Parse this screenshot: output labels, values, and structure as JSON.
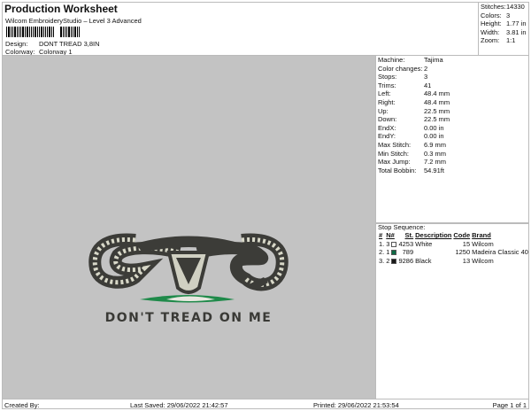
{
  "header": {
    "title": "Production Worksheet",
    "subtitle": "Wilcom EmbroideryStudio – Level 3 Advanced",
    "design_label": "Design:",
    "design_value": "DONT TREAD 3,8IN",
    "colorway_label": "Colorway:",
    "colorway_value": "Colorway 1"
  },
  "stats": [
    {
      "k": "Stitches:",
      "v": "14330"
    },
    {
      "k": "Colors:",
      "v": "3"
    },
    {
      "k": "Height:",
      "v": "1.77 in"
    },
    {
      "k": "Width:",
      "v": "3.81 in"
    },
    {
      "k": "Zoom:",
      "v": "1:1"
    }
  ],
  "details": [
    {
      "k": "Machine:",
      "v": "Tajima"
    },
    {
      "k": "Color changes:",
      "v": "2"
    },
    {
      "k": "Stops:",
      "v": "3"
    },
    {
      "k": "Trims:",
      "v": "41"
    },
    {
      "k": "Left:",
      "v": "48.4 mm"
    },
    {
      "k": "Right:",
      "v": "48.4 mm"
    },
    {
      "k": "Up:",
      "v": "22.5 mm"
    },
    {
      "k": "Down:",
      "v": "22.5 mm"
    },
    {
      "k": "EndX:",
      "v": "0.00 in"
    },
    {
      "k": "EndY:",
      "v": "0.00 in"
    },
    {
      "k": "Max Stitch:",
      "v": "6.9 mm"
    },
    {
      "k": "Min Stitch:",
      "v": "0.3 mm"
    },
    {
      "k": "Max Jump:",
      "v": "7.2 mm"
    },
    {
      "k": "Total Bobbin:",
      "v": "54.91ft"
    }
  ],
  "stop_sequence": {
    "label": "Stop Sequence:",
    "headers": [
      "#",
      "N#",
      "St.",
      "Description",
      "Code",
      "Brand"
    ],
    "rows": [
      {
        "idx": "1.",
        "n": "3",
        "color": "#ffffff",
        "st": "4253",
        "desc": "White",
        "code": "15",
        "brand": "Wilcom"
      },
      {
        "idx": "2.",
        "n": "1",
        "color": "#0e6b45",
        "st": "789",
        "desc": "",
        "code": "1250",
        "brand": "Madeira Classic 40"
      },
      {
        "idx": "3.",
        "n": "2",
        "color": "#1a1a1a",
        "st": "9286",
        "desc": "Black",
        "code": "13",
        "brand": "Wilcom"
      }
    ]
  },
  "design_text": "DON'T TREAD ON ME",
  "footer": {
    "created": "Created By:",
    "saved": "Last Saved: 29/06/2022 21:42:57",
    "printed": "Printed: 29/06/2022 21:53:54",
    "page": "Page 1 of 1"
  }
}
